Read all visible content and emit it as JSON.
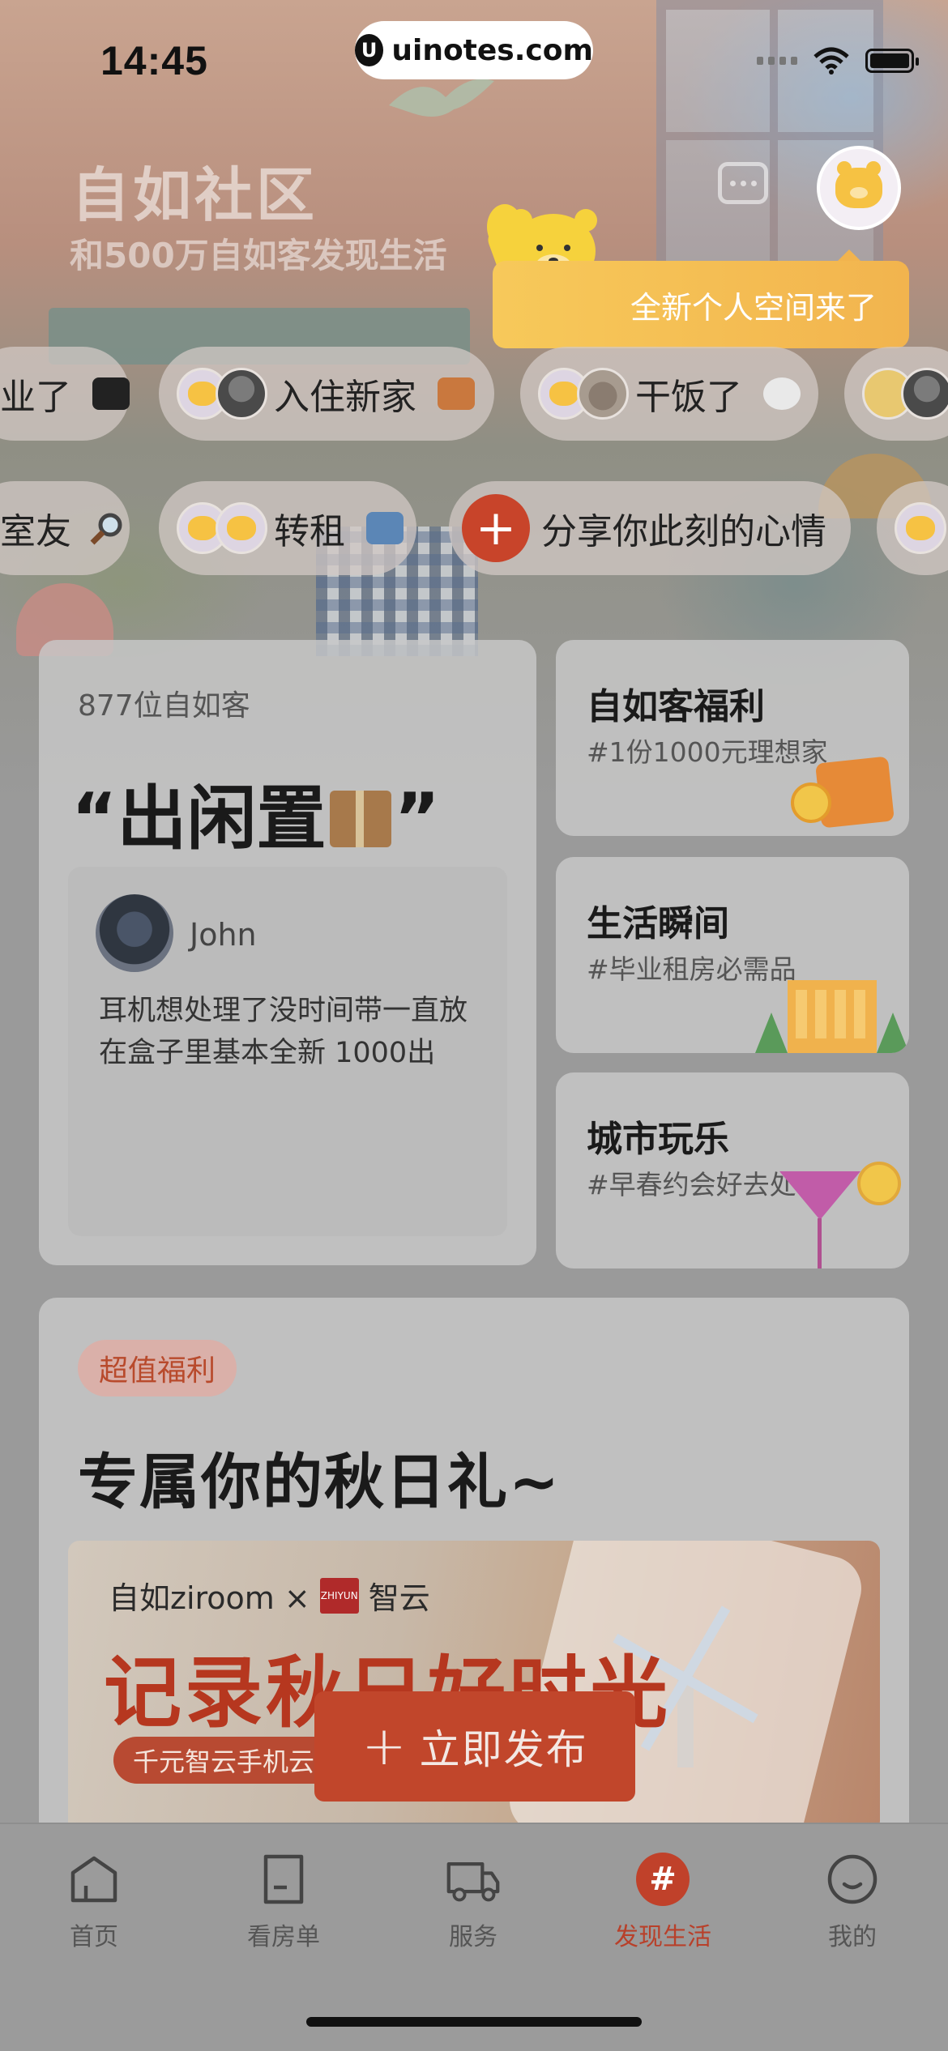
{
  "status_bar": {
    "time": "14:45",
    "watermark": "uinotes.com"
  },
  "header": {
    "title": "自如社区",
    "subtitle": "和500万自如客发现生活",
    "tooltip": "全新个人空间来了"
  },
  "chips_row1": [
    {
      "label": "业了"
    },
    {
      "label": "入住新家"
    },
    {
      "label": "干饭了"
    }
  ],
  "chips_row2": [
    {
      "label": "室友"
    },
    {
      "label": "转租"
    },
    {
      "label": "分享你此刻的心情"
    }
  ],
  "feature_card": {
    "count": "877位自如客",
    "topic_open": "“出闲置",
    "topic_close": "”",
    "post": {
      "author": "John",
      "text": "耳机想处理了没时间带一直放在盒子里基本全新 1000出"
    }
  },
  "side_cards": [
    {
      "title": "自如客福利",
      "subtitle": "#1份1000元理想家"
    },
    {
      "title": "生活瞬间",
      "subtitle": "#毕业租房必需品"
    },
    {
      "title": "城市玩乐",
      "subtitle": "#早春约会好去处"
    }
  ],
  "promo": {
    "badge": "超值福利",
    "title": "专属你的秋日礼~",
    "banner_brand": "自如ziroom × ",
    "banner_partner": "智云",
    "banner_partner_logo": "ZHIYUN",
    "banner_headline": "记录秋日好时光",
    "banner_pill": "千元智云手机云台"
  },
  "publish_button": {
    "plus": "+",
    "label": "立即发布"
  },
  "tabs": [
    {
      "label": "首页",
      "icon": "home-icon"
    },
    {
      "label": "看房单",
      "icon": "document-icon"
    },
    {
      "label": "服务",
      "icon": "truck-icon"
    },
    {
      "label": "发现生活",
      "icon": "hash-icon",
      "active": true
    },
    {
      "label": "我的",
      "icon": "smile-icon"
    }
  ],
  "colors": {
    "accent": "#c0412a",
    "tooltip": "#f2b44e"
  }
}
